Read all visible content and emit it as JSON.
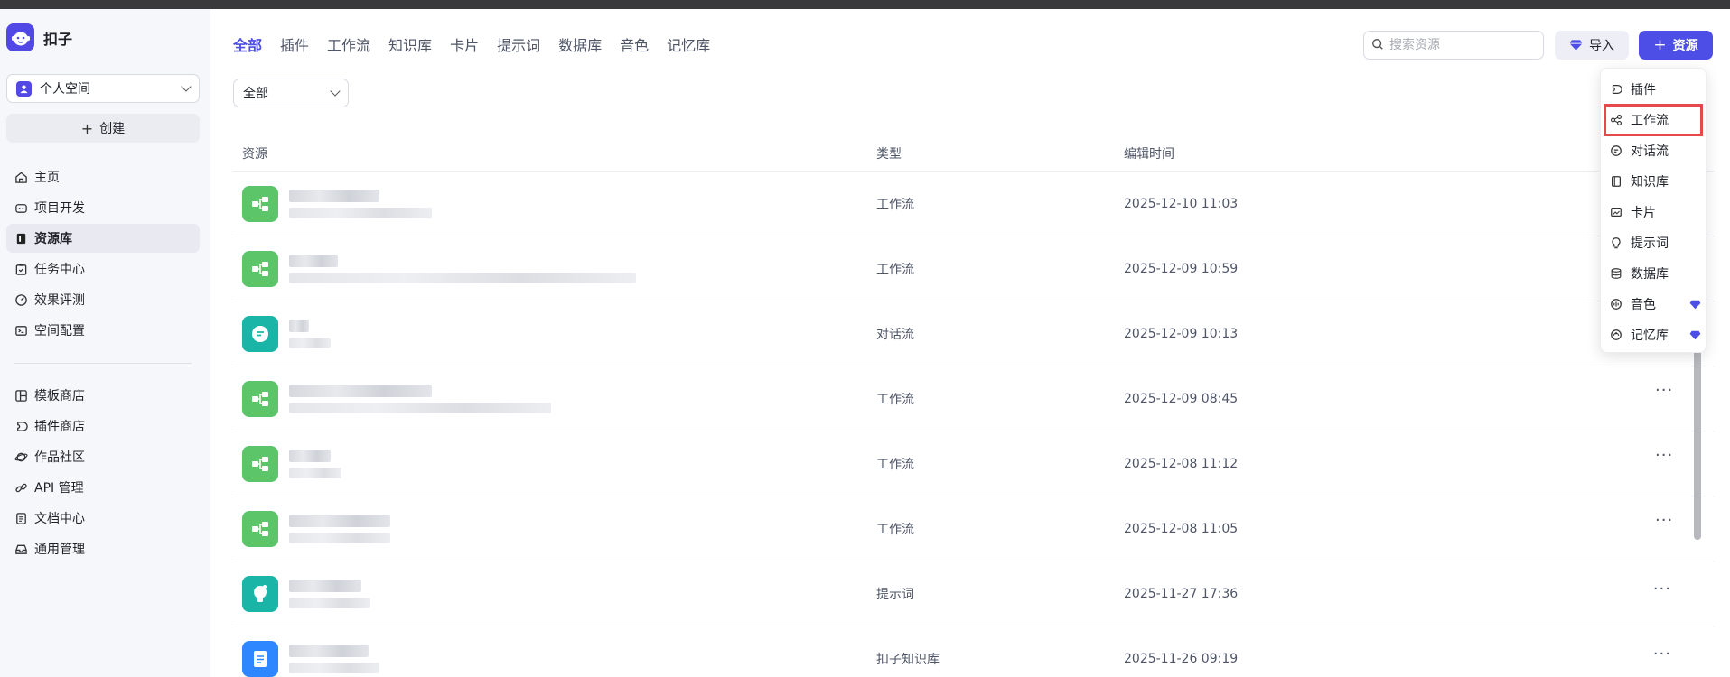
{
  "app": {
    "name": "扣子"
  },
  "sidebar": {
    "space": "个人空间",
    "create_label": "创建",
    "items": [
      {
        "label": "主页",
        "icon": "home-icon"
      },
      {
        "label": "项目开发",
        "icon": "bot-icon"
      },
      {
        "label": "资源库",
        "icon": "book-icon"
      },
      {
        "label": "任务中心",
        "icon": "clipboard-icon"
      },
      {
        "label": "效果评测",
        "icon": "gauge-icon"
      },
      {
        "label": "空间配置",
        "icon": "terminal-icon"
      }
    ],
    "items2": [
      {
        "label": "模板商店",
        "icon": "template-icon"
      },
      {
        "label": "插件商店",
        "icon": "plugin-icon"
      },
      {
        "label": "作品社区",
        "icon": "planet-icon"
      },
      {
        "label": "API 管理",
        "icon": "link-icon"
      },
      {
        "label": "文档中心",
        "icon": "document-icon"
      },
      {
        "label": "通用管理",
        "icon": "inbox-icon"
      }
    ]
  },
  "tabs": [
    "全部",
    "插件",
    "工作流",
    "知识库",
    "卡片",
    "提示词",
    "数据库",
    "音色",
    "记忆库"
  ],
  "filter": {
    "value": "全部"
  },
  "search": {
    "placeholder": "搜索资源"
  },
  "import_label": "导入",
  "add_label": "资源",
  "table": {
    "headers": [
      "资源",
      "类型",
      "编辑时间"
    ],
    "rows": [
      {
        "type": "工作流",
        "time": "2025-12-10 11:03",
        "kind": "workflow"
      },
      {
        "type": "工作流",
        "time": "2025-12-09 10:59",
        "kind": "workflow"
      },
      {
        "type": "对话流",
        "time": "2025-12-09 10:13",
        "kind": "chatflow"
      },
      {
        "type": "工作流",
        "time": "2025-12-09 08:45",
        "kind": "workflow"
      },
      {
        "type": "工作流",
        "time": "2025-12-08 11:12",
        "kind": "workflow"
      },
      {
        "type": "工作流",
        "time": "2025-12-08 11:05",
        "kind": "workflow"
      },
      {
        "type": "提示词",
        "time": "2025-11-27 17:36",
        "kind": "prompt"
      },
      {
        "type": "扣子知识库",
        "time": "2025-11-26 09:19",
        "kind": "knowledge"
      }
    ]
  },
  "menu": {
    "items": [
      {
        "label": "插件",
        "icon": "plugin-icon",
        "premium": false
      },
      {
        "label": "工作流",
        "icon": "workflow-icon",
        "premium": false
      },
      {
        "label": "对话流",
        "icon": "chat-icon",
        "premium": false
      },
      {
        "label": "知识库",
        "icon": "knowledge-icon",
        "premium": false
      },
      {
        "label": "卡片",
        "icon": "card-icon",
        "premium": false
      },
      {
        "label": "提示词",
        "icon": "bulb-icon",
        "premium": false
      },
      {
        "label": "数据库",
        "icon": "database-icon",
        "premium": false
      },
      {
        "label": "音色",
        "icon": "voice-icon",
        "premium": true
      },
      {
        "label": "记忆库",
        "icon": "memory-icon",
        "premium": true
      }
    ]
  },
  "colors": {
    "accent": "#4d4ee6",
    "workflow": "#5cc56a",
    "chatflow": "#1bb5a8",
    "knowledge": "#2f87ff",
    "highlight": "#e5484d"
  }
}
